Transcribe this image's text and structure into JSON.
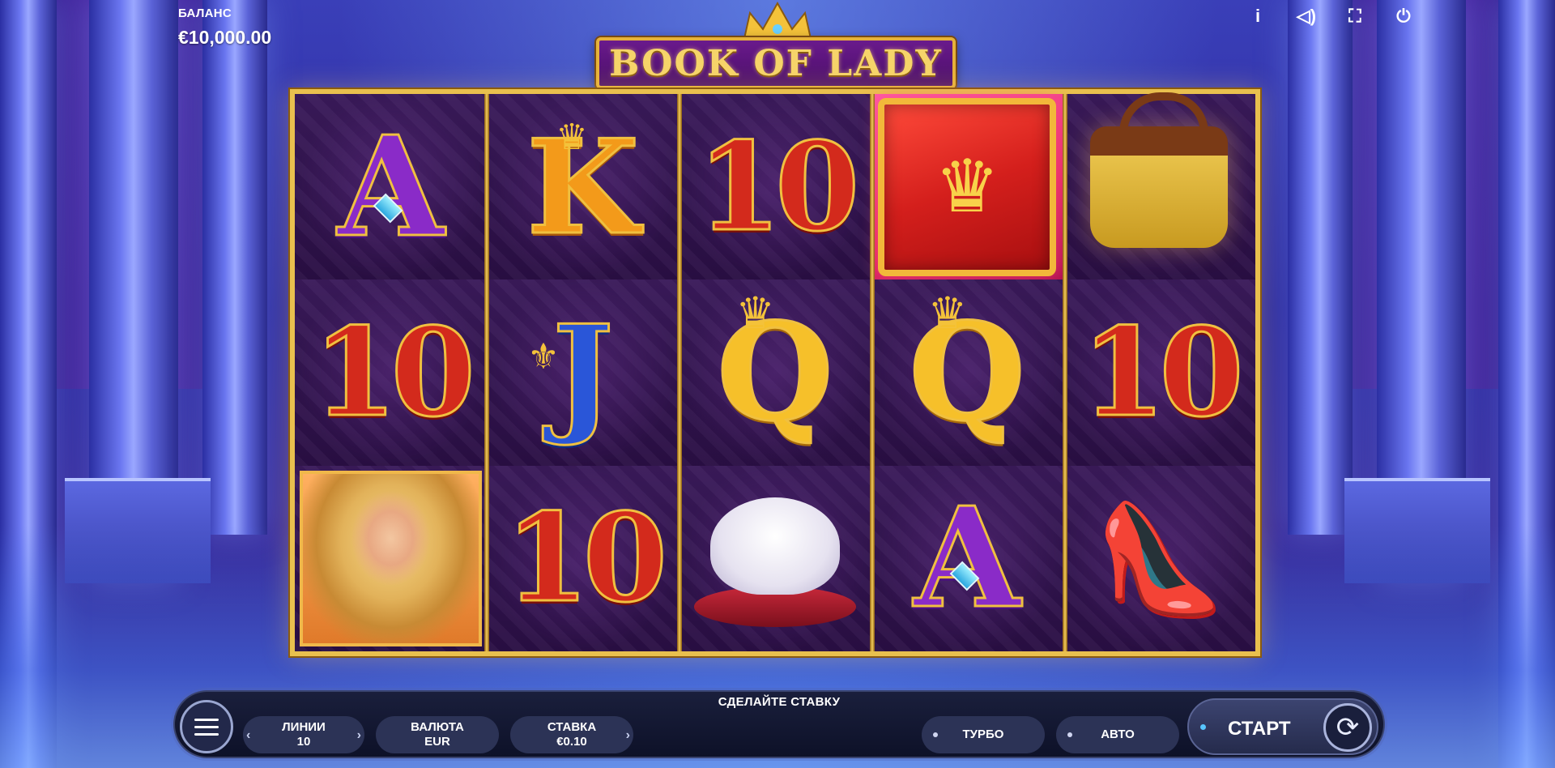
{
  "balance": {
    "label": "БАЛАНС",
    "value": "€10,000.00"
  },
  "top_icons": [
    {
      "name": "info-icon",
      "glyph": "i"
    },
    {
      "name": "sound-icon",
      "glyph": "◁)"
    },
    {
      "name": "fullscreen-icon",
      "glyph": "⛶"
    },
    {
      "name": "power-icon",
      "glyph": "⏻"
    }
  ],
  "logo": {
    "title": "BOOK OF LADY"
  },
  "reels": {
    "symbols": [
      [
        "A",
        "10",
        "lady"
      ],
      [
        "K",
        "J",
        "10"
      ],
      [
        "10",
        "Q",
        "cat"
      ],
      [
        "book",
        "Q",
        "A"
      ],
      [
        "bag",
        "10",
        "shoes"
      ]
    ],
    "labels": {
      "A": "A",
      "K": "K",
      "Q": "Q",
      "J": "J",
      "10": "10"
    }
  },
  "bottom_bar": {
    "message": "СДЕЛАЙТЕ СТАВКУ",
    "lines": {
      "label": "ЛИНИИ",
      "value": "10"
    },
    "currency": {
      "label": "ВАЛЮТА",
      "value": "EUR"
    },
    "bet": {
      "label": "СТАВКА",
      "value": "€0.10"
    },
    "turbo_label": "ТУРБО",
    "auto_label": "АВТО",
    "start_label": "СТАРТ"
  },
  "colors": {
    "frame_gold": "#e9c04e",
    "reel_bg": "#2a0f3f",
    "bar_bg": "#0d1128"
  }
}
